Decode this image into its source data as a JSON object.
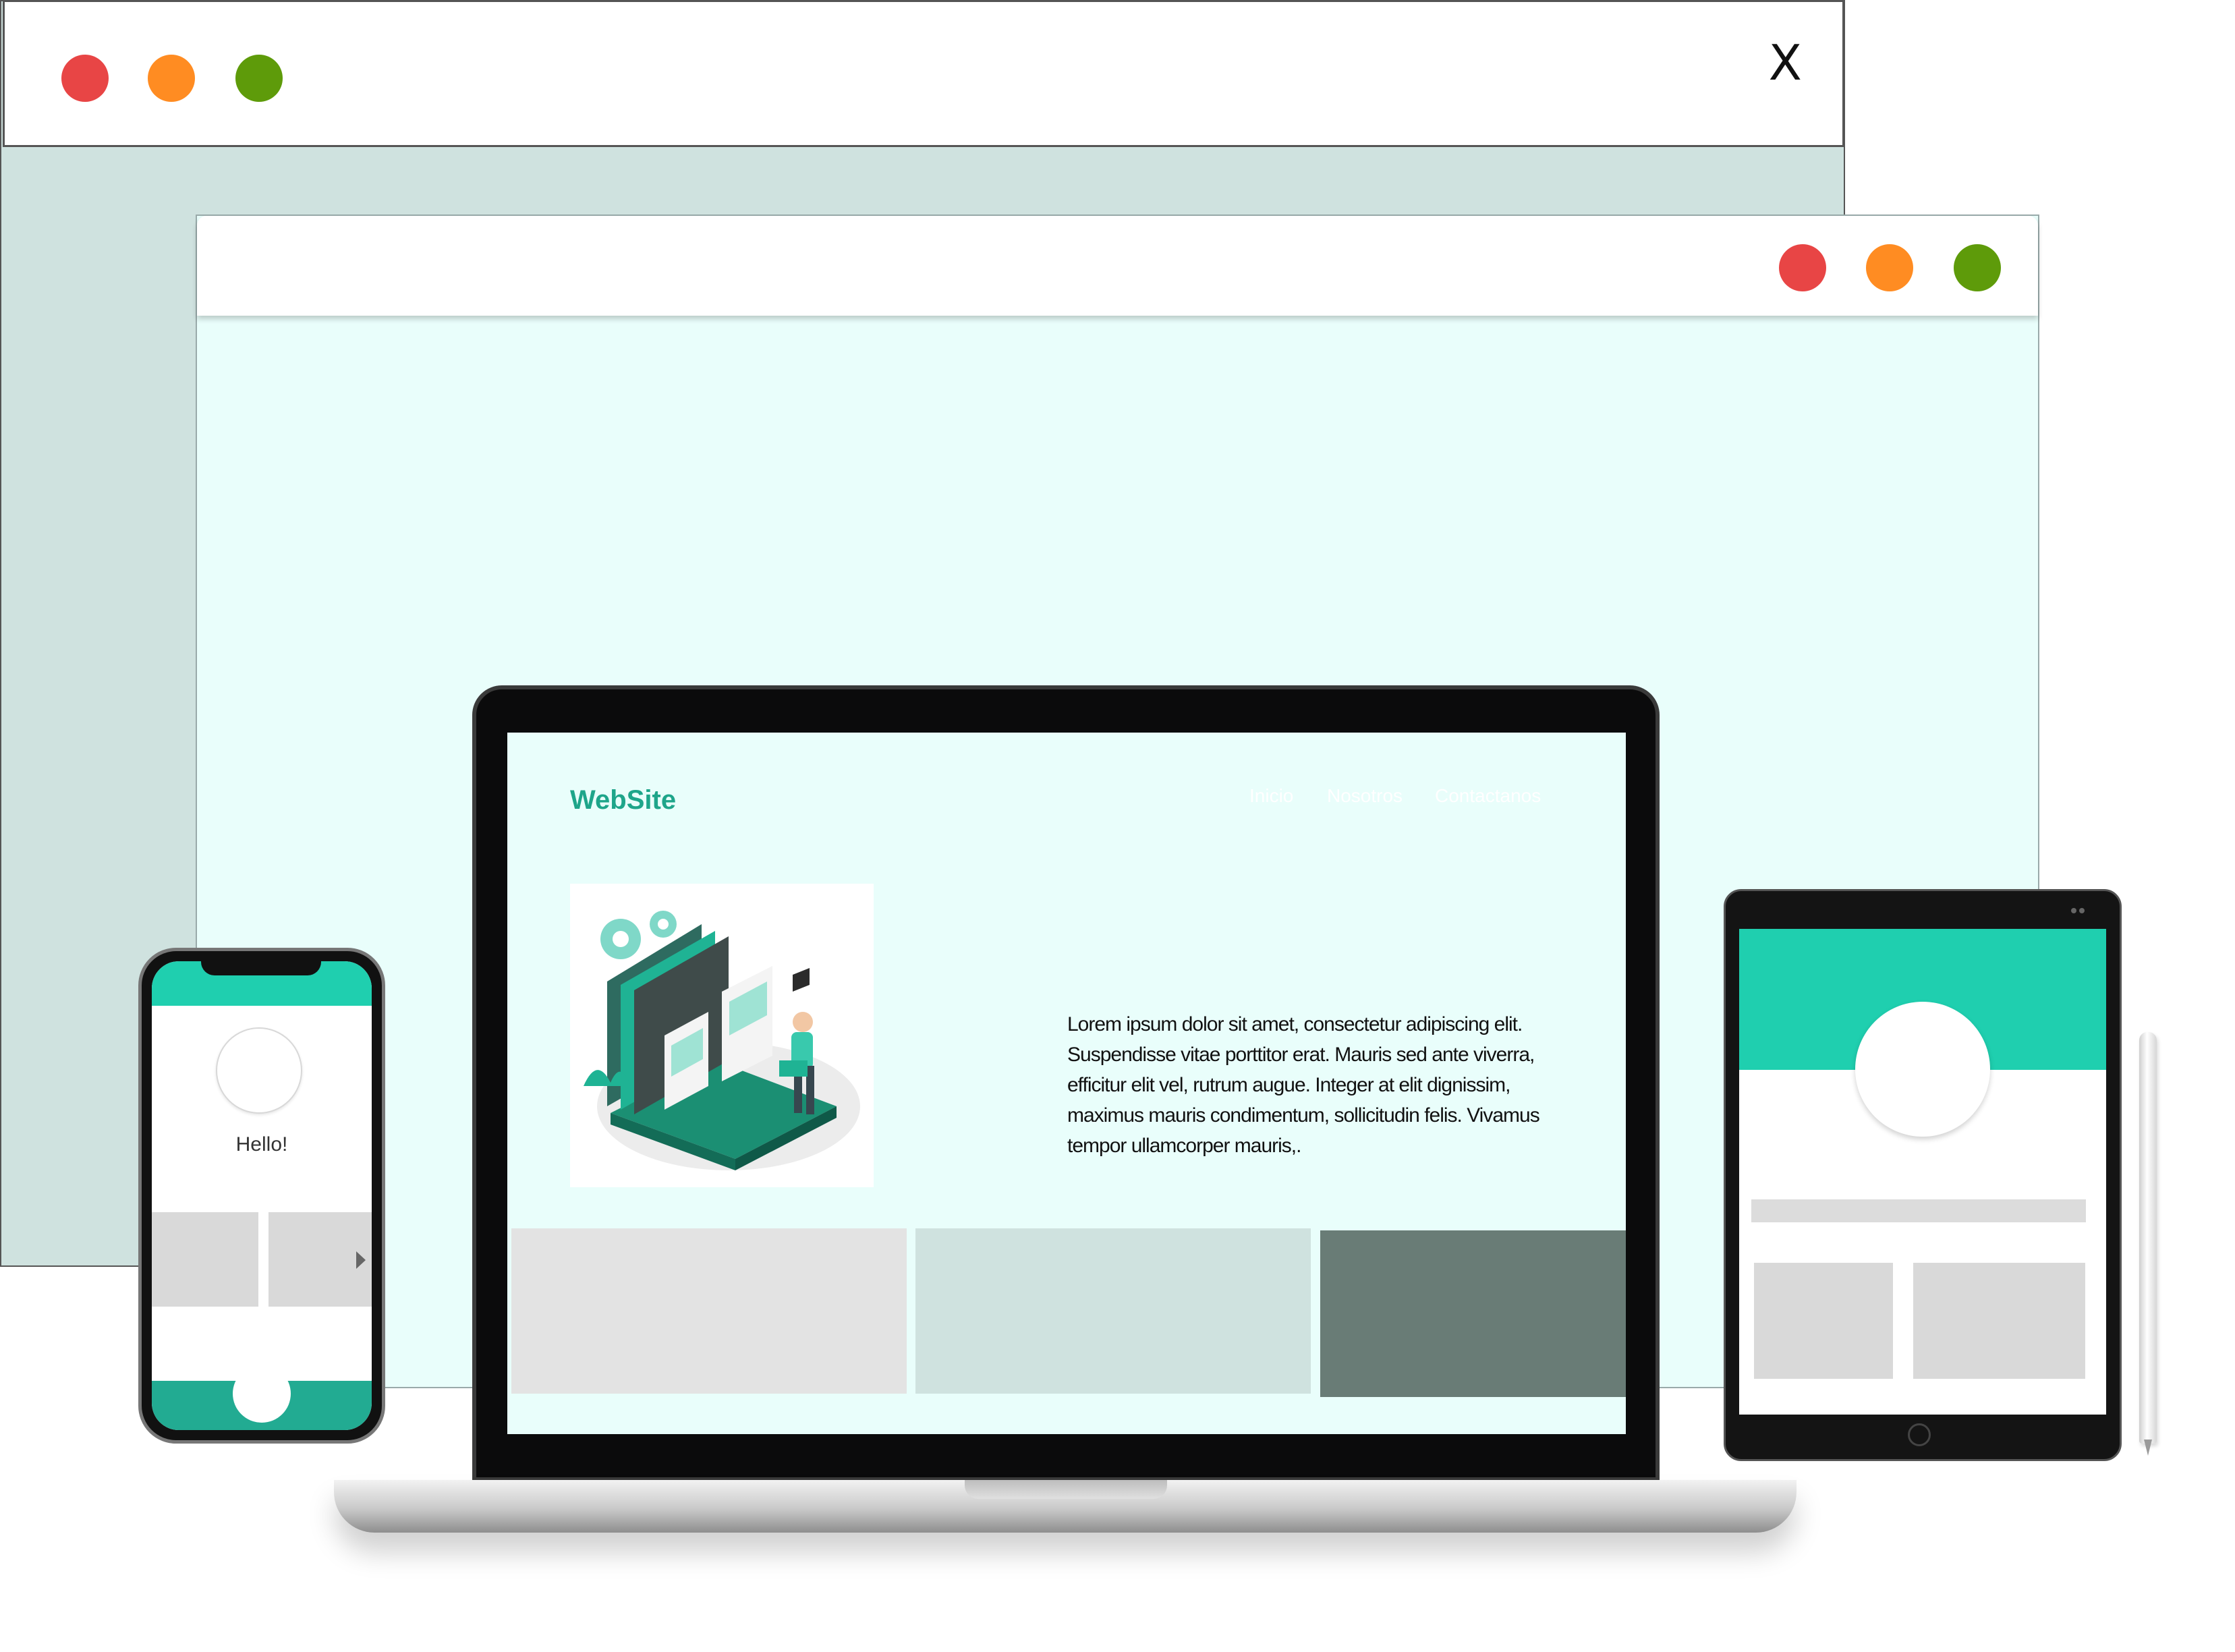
{
  "back_window": {
    "close_label": "X",
    "controls": {
      "red": "#e84545",
      "orange": "#ff8c22",
      "green": "#5e9b0a"
    },
    "background": "#cfe2df"
  },
  "front_window": {
    "background": "#e9fefb"
  },
  "laptop_site": {
    "logo": "WebSite",
    "nav": [
      "Inicio",
      "Nosotros",
      "Contactanos"
    ],
    "body_text": "Lorem ipsum dolor sit amet, consectetur adipiscing elit. Suspendisse vitae porttitor erat. Mauris sed ante viverra, efficitur elit vel, rutrum augue. Integer at elit dignissim, maximus mauris condimentum, sollicitudin felis. Vivamus tempor ullamcorper mauris,.",
    "card_colors": [
      "#e3e3e3",
      "#cfe2df",
      "#697c76"
    ],
    "accent": "#1ea58a"
  },
  "phone": {
    "greeting": "Hello!",
    "accent": "#1fcfaf",
    "footer": "#22ab92"
  },
  "tablet": {
    "accent": "#1fcfaf"
  }
}
